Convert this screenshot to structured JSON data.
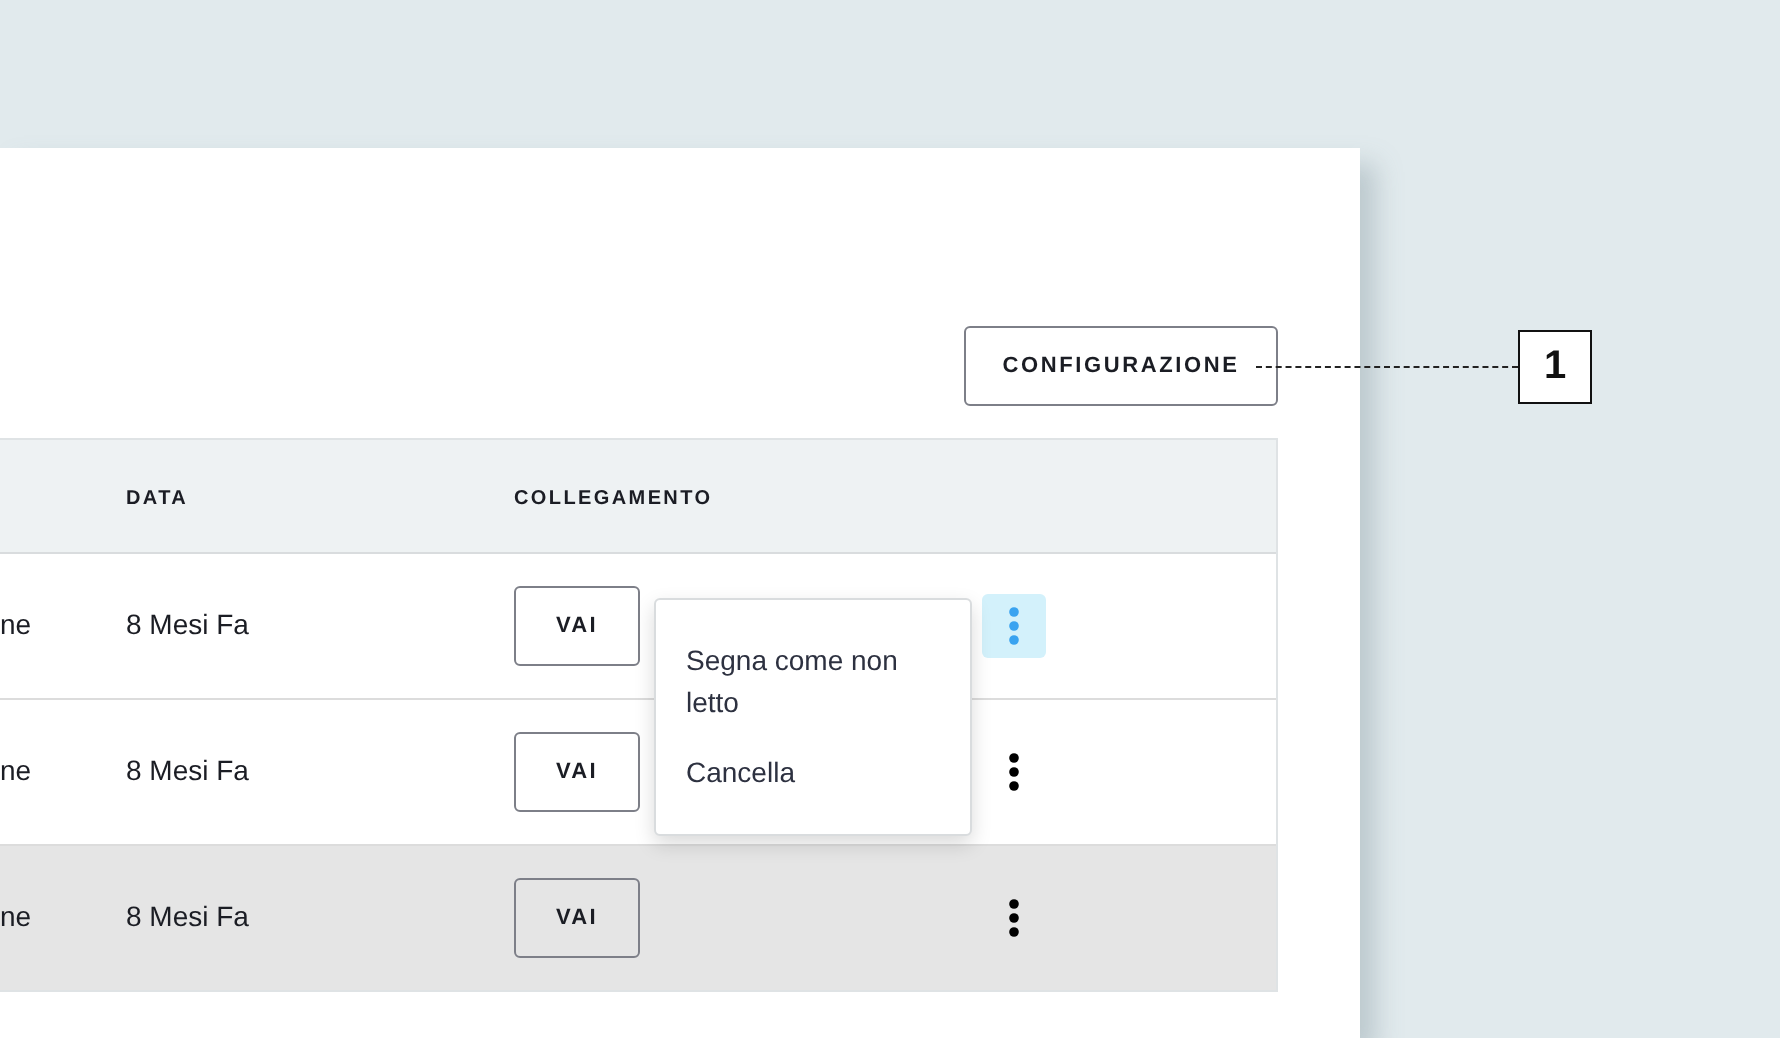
{
  "toolbar": {
    "button": "CONFIGURAZIONE"
  },
  "table": {
    "columns": [
      "DATA",
      "COLLEGAMENTO"
    ],
    "rows": [
      {
        "column_1": "ne",
        "data": "8 Mesi Fa",
        "link": "VAI",
        "menu_open": true,
        "hovered": false
      },
      {
        "column_1": "ne",
        "data": "8 Mesi Fa",
        "link": "VAI",
        "menu_open": false,
        "hovered": false
      },
      {
        "column_1": "ne",
        "data": "8 Mesi Fa",
        "link": "VAI",
        "menu_open": false,
        "hovered": true
      }
    ]
  },
  "row_menu": {
    "items": [
      "Segna come non letto",
      "Cancella"
    ]
  },
  "callout": {
    "label": "1"
  }
}
